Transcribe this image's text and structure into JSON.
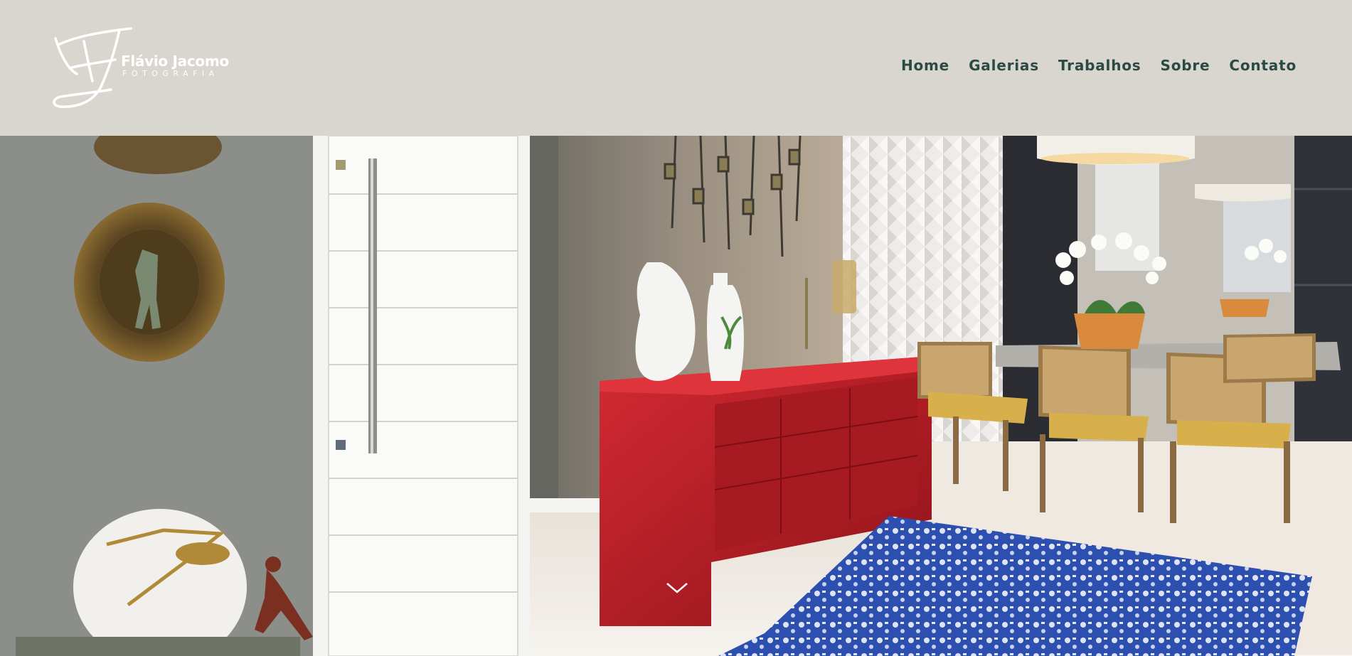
{
  "brand": {
    "name": "Flávio Jacomo",
    "tagline": "FOTOGRAFIA",
    "logo_icon": "fj-monogram-icon"
  },
  "nav": {
    "items": [
      {
        "label": "Home"
      },
      {
        "label": "Galerias"
      },
      {
        "label": "Trabalhos"
      },
      {
        "label": "Sobre"
      },
      {
        "label": "Contato"
      }
    ]
  },
  "hero": {
    "scroll_icon": "chevron-down-icon"
  },
  "colors": {
    "header_bg": "#d9d5cf",
    "nav_text": "#2c4a44",
    "logo_text": "#ffffff",
    "bottom_bar": "#1b2f45"
  }
}
